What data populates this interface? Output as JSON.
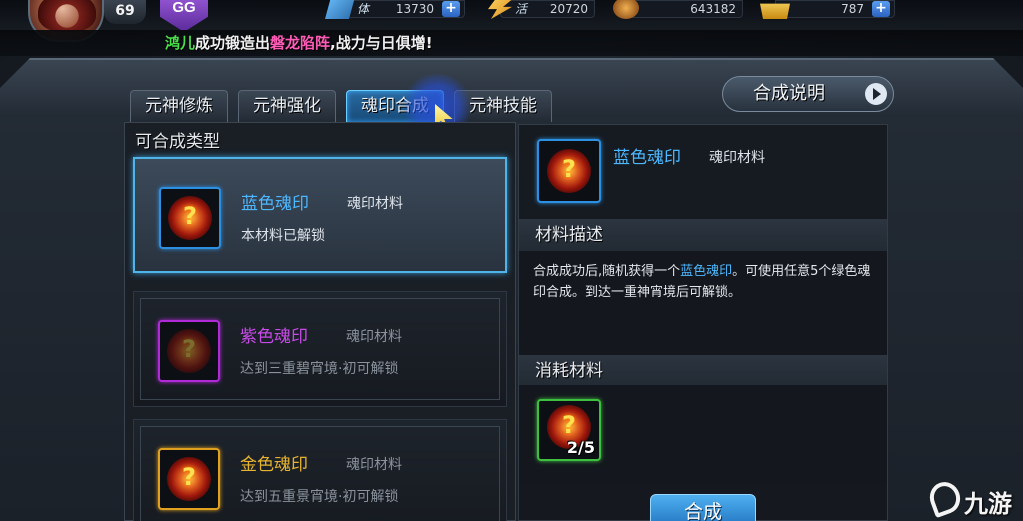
{
  "header": {
    "level": "69",
    "gg_label": "GG",
    "resources": [
      {
        "icon": "stamina-icon",
        "label": "体",
        "value": "13730",
        "has_plus": true
      },
      {
        "icon": "energy-icon",
        "label": "活",
        "value": "20720",
        "has_plus": false
      },
      {
        "icon": "coin-icon",
        "label": "",
        "value": "643182",
        "has_plus": false
      },
      {
        "icon": "gold-ingot-icon",
        "label": "",
        "value": "787",
        "has_plus": true
      }
    ]
  },
  "announcement": {
    "player": "鸿儿",
    "text_1": "成功锻造出",
    "item": "磐龙陷阵",
    "text_2": ",战力与日俱增!"
  },
  "tabs": [
    {
      "label": "元神修炼",
      "active": false
    },
    {
      "label": "元神强化",
      "active": false
    },
    {
      "label": "魂印合成",
      "active": true
    },
    {
      "label": "元神技能",
      "active": false
    }
  ],
  "help_button": "合成说明",
  "list": {
    "title": "可合成类型",
    "items": [
      {
        "name": "蓝色魂印",
        "category": "魂印材料",
        "status": "本材料已解锁",
        "rarity": "blue",
        "selected": true
      },
      {
        "name": "紫色魂印",
        "category": "魂印材料",
        "status": "达到三重碧宵境·初可解锁",
        "rarity": "purple",
        "selected": false
      },
      {
        "name": "金色魂印",
        "category": "魂印材料",
        "status": "达到五重景宵境·初可解锁",
        "rarity": "gold",
        "selected": false
      }
    ]
  },
  "detail": {
    "name": "蓝色魂印",
    "category": "魂印材料",
    "desc_title": "材料描述",
    "desc_1": "合成成功后,随机获得一个",
    "desc_hl": "蓝色魂印",
    "desc_2": "。可使用任意5个绿色魂印合成。到达一重神宵境后可解锁。",
    "consume_title": "消耗材料",
    "consume_count": "2/5",
    "combine_button": "合成"
  },
  "watermark": "九游",
  "colors": {
    "blue": "#4db8ff",
    "purple": "#c84ae8",
    "gold": "#e8b430",
    "green_border": "#3fbf3f"
  }
}
